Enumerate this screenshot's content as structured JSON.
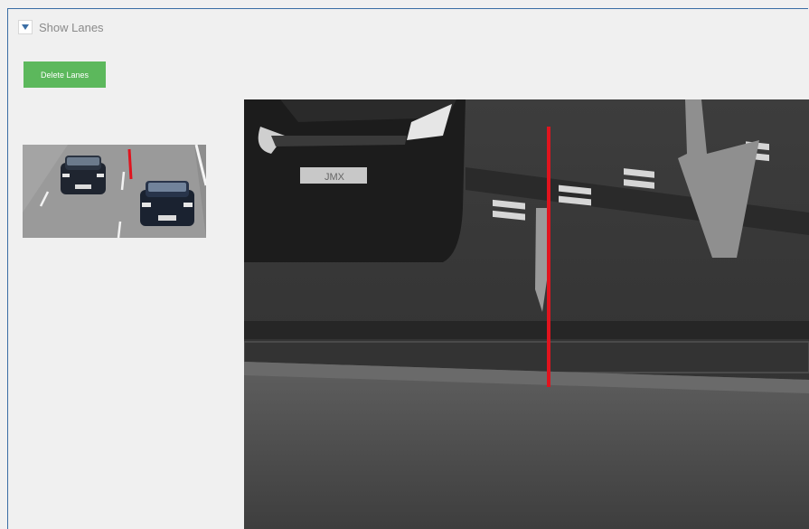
{
  "section": {
    "toggle_icon": "triangle-down-icon",
    "title": "Show Lanes"
  },
  "actions": {
    "delete_label": "Delete Lanes"
  },
  "colors": {
    "button": "#5cb85c",
    "lane_line": "#e0141e",
    "frame_border": "#3a6ea5"
  }
}
